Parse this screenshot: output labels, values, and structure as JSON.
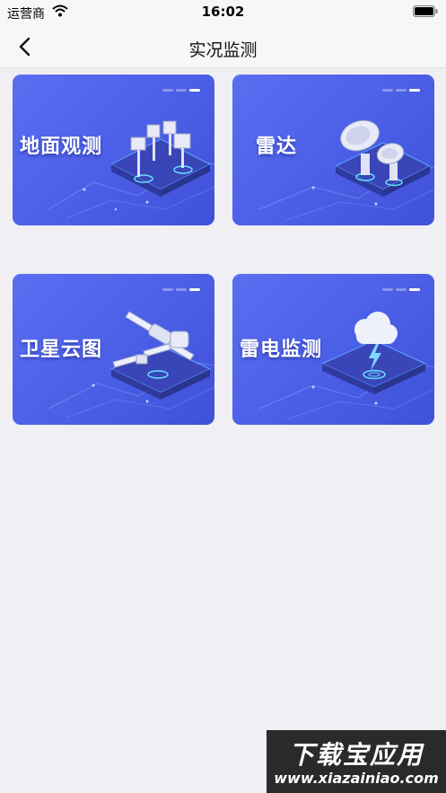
{
  "status_bar": {
    "carrier": "运营商",
    "time": "16:02"
  },
  "nav": {
    "title": "实况监测",
    "back_icon": "chevron-left-icon"
  },
  "cards": [
    {
      "label": "地面观测",
      "icon": "weather-station-icon"
    },
    {
      "label": "雷达",
      "icon": "radar-dish-icon"
    },
    {
      "label": "卫星云图",
      "icon": "satellite-icon"
    },
    {
      "label": "雷电监测",
      "icon": "lightning-cloud-icon"
    }
  ],
  "watermark": {
    "title": "下载宝应用",
    "url": "www.xiazainiao.com"
  },
  "colors": {
    "card_blue": "#4b5ee6",
    "background": "#efeff4"
  }
}
